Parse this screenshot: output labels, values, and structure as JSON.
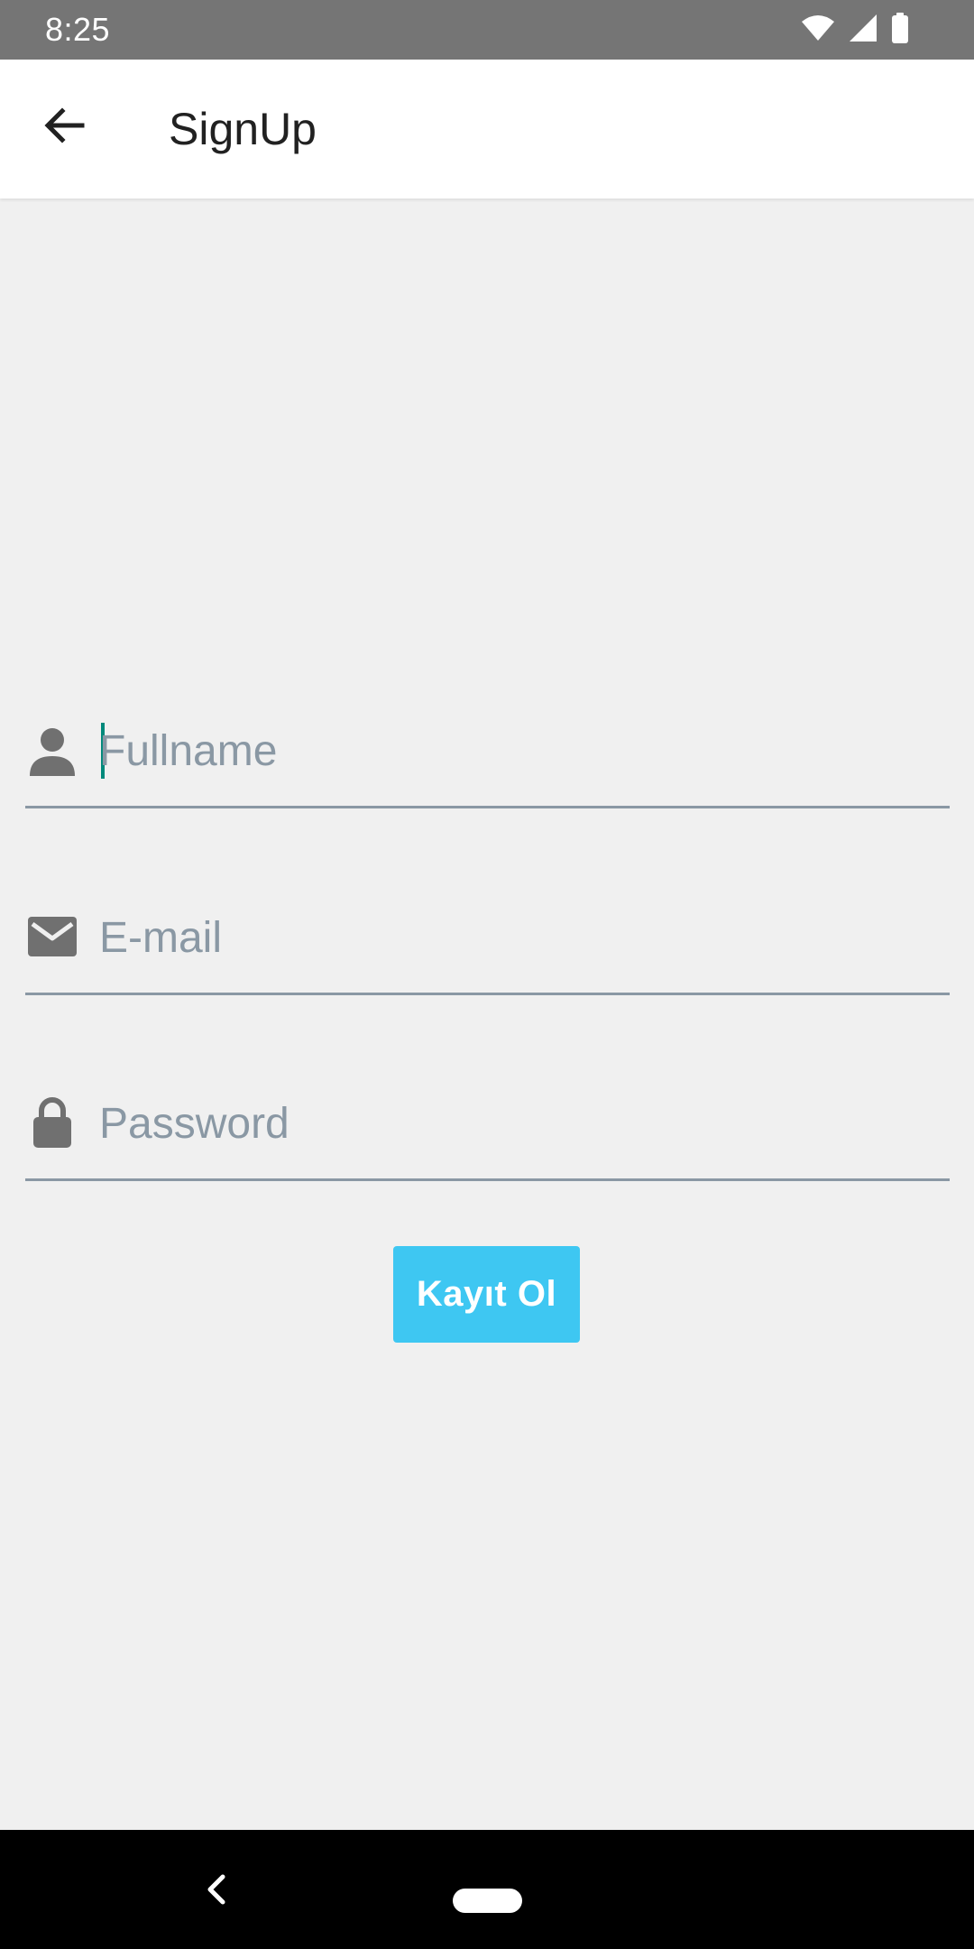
{
  "status_bar": {
    "time": "8:25",
    "icons": [
      "wifi-icon",
      "signal-icon",
      "battery-icon"
    ]
  },
  "app_bar": {
    "title": "SignUp",
    "back_icon": "arrow-back-icon"
  },
  "form": {
    "fullname": {
      "placeholder": "Fullname",
      "value": "",
      "icon": "person-icon"
    },
    "email": {
      "placeholder": "E-mail",
      "value": "",
      "icon": "email-icon"
    },
    "password": {
      "placeholder": "Password",
      "value": "",
      "icon": "lock-icon"
    },
    "submit_label": "Kayıt Ol"
  },
  "nav_bar": {
    "back_icon": "nav-back-icon",
    "home_icon": "nav-home-pill"
  },
  "colors": {
    "status_bar": "#757575",
    "app_bar": "#ffffff",
    "background": "#f0f0f0",
    "button": "#3ec7f2",
    "caret": "#00897b",
    "underline": "#8a98a4",
    "icon": "#707070"
  }
}
